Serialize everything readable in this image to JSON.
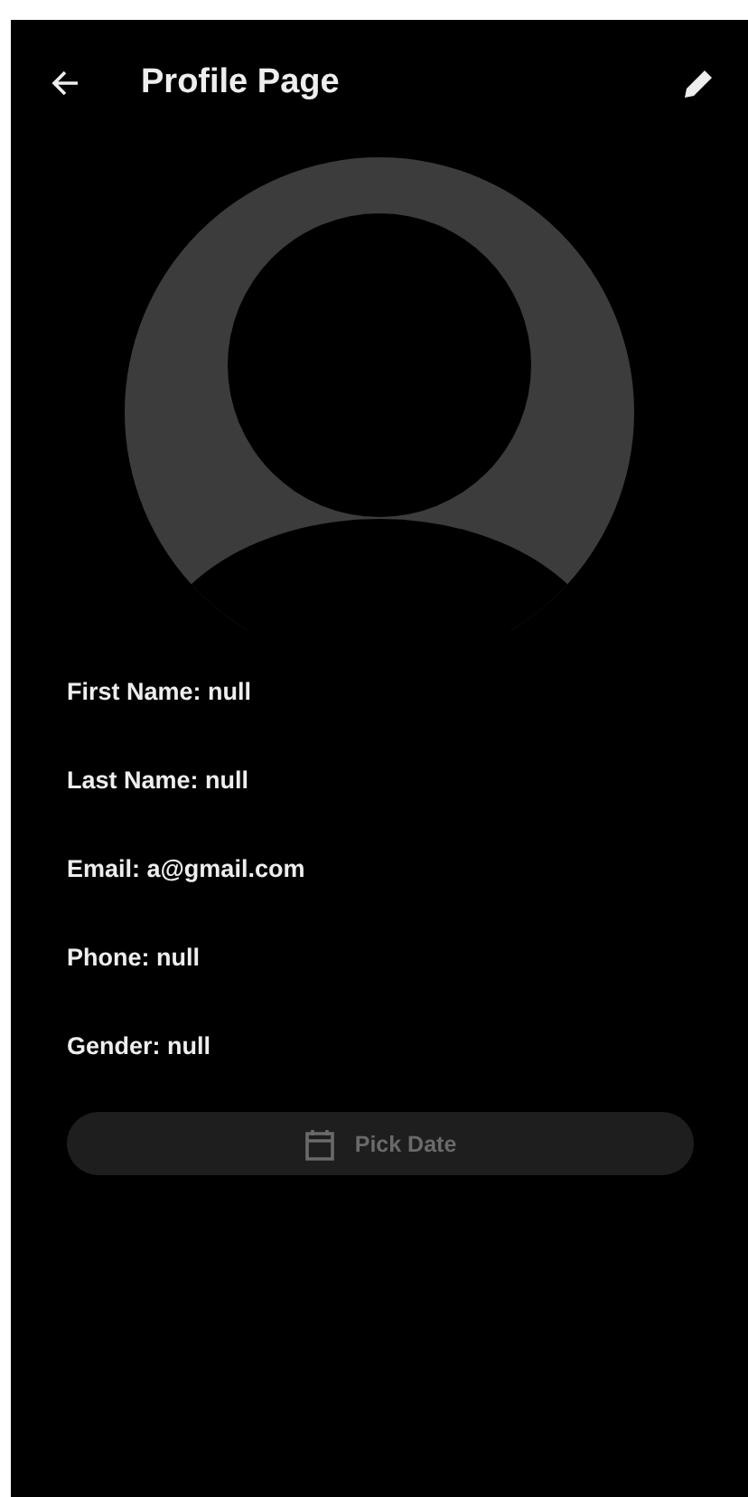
{
  "app_bar": {
    "title": "Profile Page"
  },
  "fields": [
    {
      "text": "First Name: null"
    },
    {
      "text": "Last Name: null"
    },
    {
      "text": "Email: a@gmail.com"
    },
    {
      "text": "Phone: null"
    },
    {
      "text": "Gender: null"
    }
  ],
  "pick_date_button": {
    "label": "Pick Date",
    "disabled": true
  }
}
